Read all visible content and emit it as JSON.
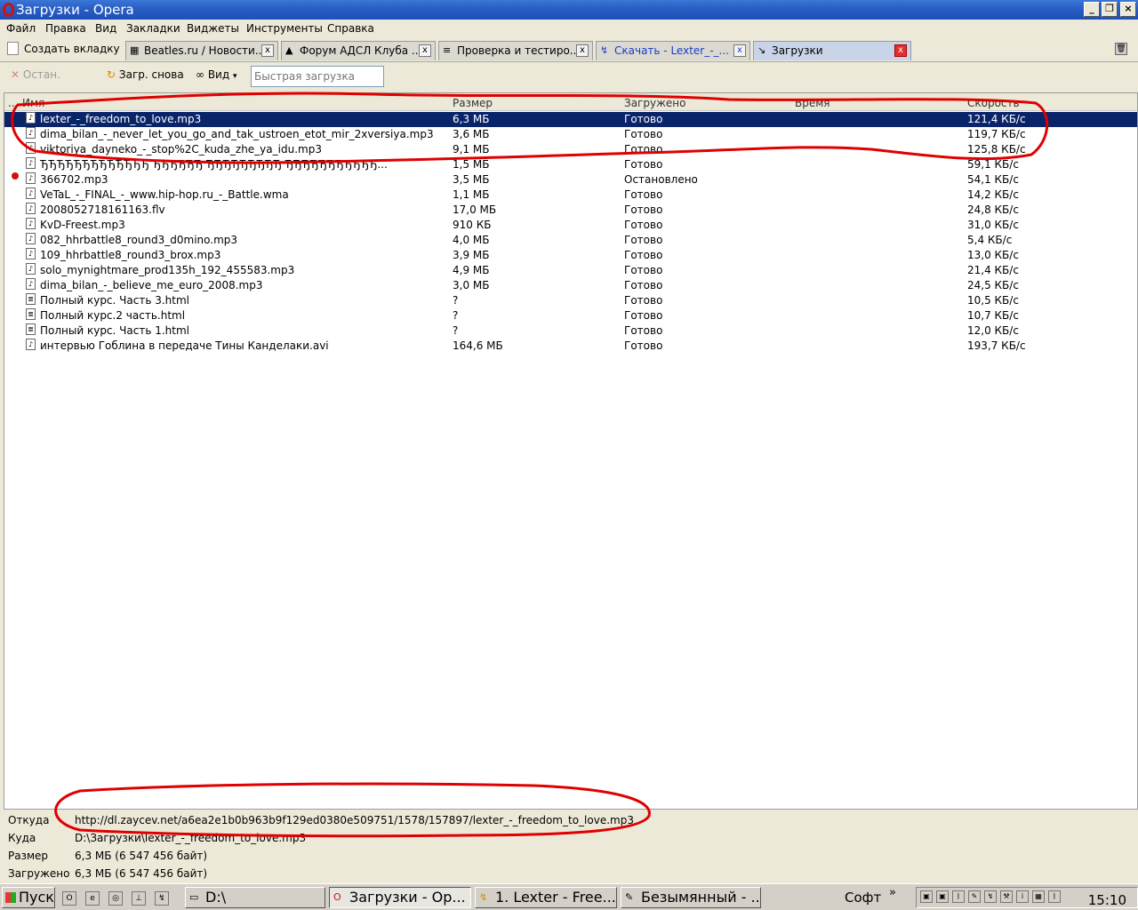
{
  "window": {
    "title": "Загрузки - Opera",
    "minimize_glyph": "_",
    "restore_glyph": "❐",
    "close_glyph": "×"
  },
  "menu": [
    "Файл",
    "Правка",
    "Вид",
    "Закладки",
    "Виджеты",
    "Инструменты",
    "Справка"
  ],
  "tabs": {
    "new_tab_label": "Создать вкладку",
    "items": [
      {
        "label": "Beatles.ru / Новости...",
        "icon": "beatles-icon"
      },
      {
        "label": "Форум АДСЛ Клуба ...",
        "icon": "forum-icon"
      },
      {
        "label": "Проверка и тестиро...",
        "icon": "chart-icon"
      },
      {
        "label": "Скачать - Lexter_-_...",
        "icon": "download-icon"
      },
      {
        "label": "Загрузки",
        "icon": "transfers-icon"
      }
    ],
    "close_glyph": "x",
    "trash_glyph": "🗑"
  },
  "toolbar": {
    "stop_label": "Остан.",
    "resume_label": "Загр. снова",
    "view_label": "Вид",
    "quick_placeholder": "Быстрая загрузка"
  },
  "list": {
    "columns": {
      "name": "Имя",
      "size": "Размер",
      "loaded": "Загружено",
      "time": "Время",
      "speed": "Скорость"
    },
    "rows": [
      {
        "name": "lexter_-_freedom_to_love.mp3",
        "size": "6,3 МБ",
        "status": "Готово",
        "speed": "121,4 КБ/с"
      },
      {
        "name": "dima_bilan_-_never_let_you_go_and_tak_ustroen_etot_mir_2xversiya.mp3",
        "size": "3,6 МБ",
        "status": "Готово",
        "speed": "119,7 КБ/с"
      },
      {
        "name": "viktoriya_dayneko_-_stop%2C_kuda_zhe_ya_idu.mp3",
        "size": "9,1 МБ",
        "status": "Готово",
        "speed": "125,8 КБ/с"
      },
      {
        "name": "ЂЂЂЂЂЂЂЂЂЂЂЂЂ ЂЂЂЂЂЂ ЂЂЂЂЂЂЂЂЂ ЂЂЂЂЂЂЂЂЂЂЂ...",
        "size": "1,5 МБ",
        "status": "Готово",
        "speed": "59,1 КБ/с"
      },
      {
        "name": "366702.mp3",
        "size": "3,5 МБ",
        "status": "Остановлено",
        "speed": "54,1 КБ/с"
      },
      {
        "name": "VeTaL_-_FINAL_-_www.hip-hop.ru_-_Battle.wma",
        "size": "1,1 МБ",
        "status": "Готово",
        "speed": "14,2 КБ/с"
      },
      {
        "name": "2008052718161163.flv",
        "size": "17,0 МБ",
        "status": "Готово",
        "speed": "24,8 КБ/с"
      },
      {
        "name": "KvD-Freest.mp3",
        "size": "910 КБ",
        "status": "Готово",
        "speed": "31,0 КБ/с"
      },
      {
        "name": "082_hhrbattle8_round3_d0mino.mp3",
        "size": "4,0 МБ",
        "status": "Готово",
        "speed": "5,4 КБ/с"
      },
      {
        "name": "109_hhrbattle8_round3_brox.mp3",
        "size": "3,9 МБ",
        "status": "Готово",
        "speed": "13,0 КБ/с"
      },
      {
        "name": "solo_mynightmare_prod135h_192_455583.mp3",
        "size": "4,9 МБ",
        "status": "Готово",
        "speed": "21,4 КБ/с"
      },
      {
        "name": "dima_bilan_-_believe_me_euro_2008.mp3",
        "size": "3,0 МБ",
        "status": "Готово",
        "speed": "24,5 КБ/с"
      },
      {
        "name": "Полный курс. Часть 3.html",
        "size": "?",
        "status": "Готово",
        "speed": "10,5 КБ/с"
      },
      {
        "name": "Полный курс.2 часть.html",
        "size": "?",
        "status": "Готово",
        "speed": "10,7 КБ/с"
      },
      {
        "name": "Полный курс. Часть 1.html",
        "size": "?",
        "status": "Готово",
        "speed": "12,0 КБ/с"
      },
      {
        "name": "интервью Гоблина в передаче Тины Канделаки.avi",
        "size": "164,6 МБ",
        "status": "Готово",
        "speed": "193,7 КБ/с"
      }
    ]
  },
  "details": {
    "from_label": "Откуда",
    "from_value": "http://dl.zaycev.net/a6ea2e1b0b963b9f129ed0380e509751/1578/157897/lexter_-_freedom_to_love.mp3",
    "to_label": "Куда",
    "to_value": "D:\\Загрузки\\lexter_-_freedom_to_love.mp3",
    "size_label": "Размер",
    "size_value": "6,3 МБ (6 547 456 байт)",
    "loaded_label": "Загружено",
    "loaded_value": "6,3 МБ (6 547 456 байт)"
  },
  "taskbar": {
    "start_label": "Пуск",
    "tasks": [
      {
        "label": "D:\\"
      },
      {
        "label": "Загрузки - Op..."
      },
      {
        "label": "1. Lexter - Free..."
      },
      {
        "label": "Безымянный - ..."
      }
    ],
    "toolbar_label": "Софт",
    "more_glyph": "»",
    "clock": "15:10"
  },
  "annotation_color": "#e00000"
}
